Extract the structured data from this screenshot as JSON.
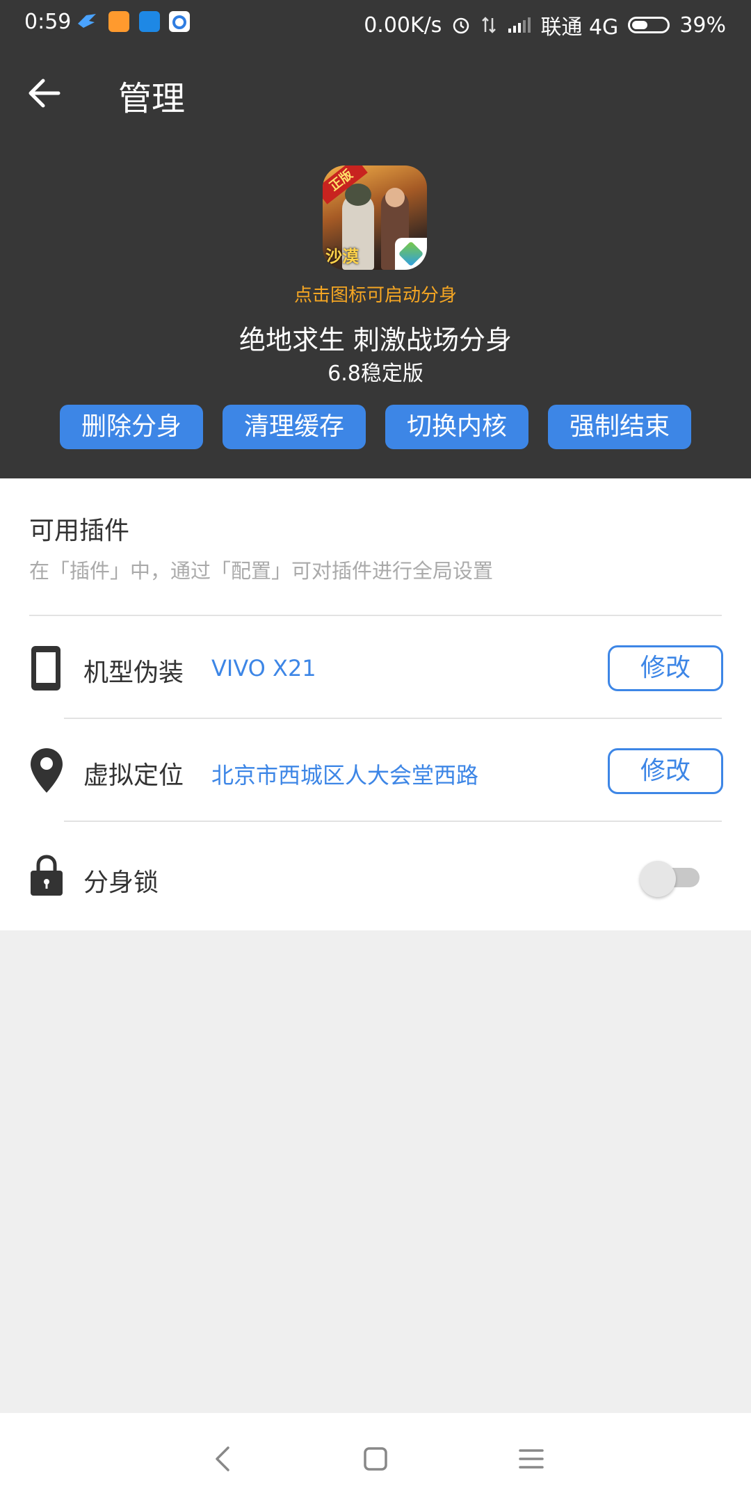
{
  "status": {
    "time": "0:59",
    "speed": "0.00K/s",
    "carrier": "联通 4G",
    "battery": "39%",
    "battery_level": 0.39
  },
  "header": {
    "title": "管理"
  },
  "app": {
    "icon_badge": "正版",
    "icon_label": "沙漠",
    "hint": "点击图标可启动分身",
    "name": "绝地求生 刺激战场分身",
    "version": "6.8稳定版"
  },
  "actions": [
    {
      "label": "删除分身"
    },
    {
      "label": "清理缓存"
    },
    {
      "label": "切换内核"
    },
    {
      "label": "强制结束"
    }
  ],
  "plugins": {
    "title": "可用插件",
    "subtitle": "在「插件」中，通过「配置」可对插件进行全局设置",
    "device": {
      "label": "机型伪装",
      "value": "VIVO X21",
      "button": "修改"
    },
    "location": {
      "label": "虚拟定位",
      "value": "北京市西城区人大会堂西路",
      "button": "修改"
    },
    "lock": {
      "label": "分身锁",
      "enabled": false
    }
  },
  "colors": {
    "accent": "#3d86e6",
    "hint": "#f5a623",
    "header_bg": "#373737"
  }
}
